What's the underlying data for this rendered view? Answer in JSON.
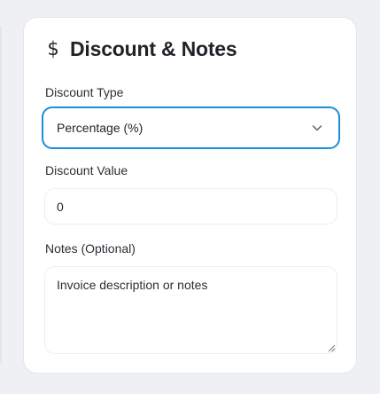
{
  "card": {
    "icon": "dollar-icon",
    "title": "Discount & Notes"
  },
  "discount_type": {
    "label": "Discount Type",
    "selected": "Percentage (%)"
  },
  "discount_value": {
    "label": "Discount Value",
    "value": "0"
  },
  "notes": {
    "label": "Notes (Optional)",
    "value": "Invoice description or notes"
  },
  "colors": {
    "focus_border": "#1e8fd0",
    "page_background": "#eef0f3",
    "card_background": "#ffffff",
    "text": "#1f2328"
  }
}
